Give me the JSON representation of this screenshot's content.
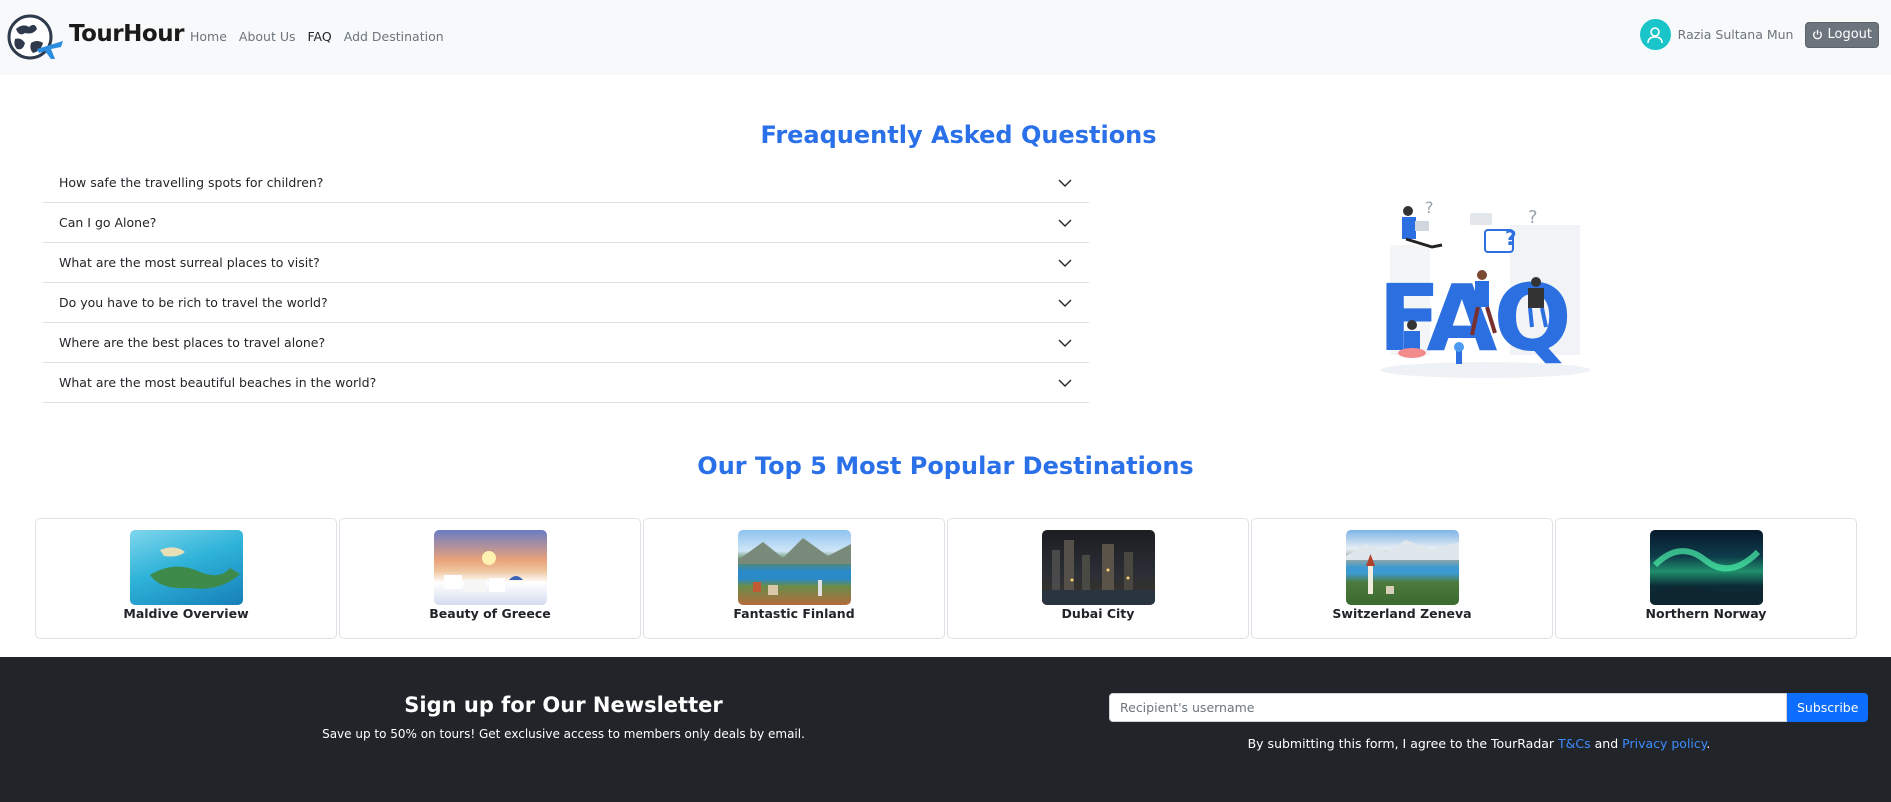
{
  "brand": {
    "name": "TourHour"
  },
  "nav": {
    "links": [
      {
        "label": "Home"
      },
      {
        "label": "About Us"
      },
      {
        "label": "FAQ"
      },
      {
        "label": "Add Destination"
      }
    ],
    "user_name": "Razia Sultana Mun",
    "logout_label": "Logout"
  },
  "faq": {
    "title": "Freaquently Asked Questions",
    "items": [
      {
        "question": "How safe the travelling spots for children?"
      },
      {
        "question": "Can I go Alone?"
      },
      {
        "question": "What are the most surreal places to visit?"
      },
      {
        "question": "Do you have to be rich to travel the world?"
      },
      {
        "question": "Where are the best places to travel alone?"
      },
      {
        "question": "What are the most beautiful beaches in the world?"
      }
    ],
    "illustration_text": "FAQ"
  },
  "destinations": {
    "title": "Our Top 5 Most Popular Destinations",
    "items": [
      {
        "name": "Maldive Overview"
      },
      {
        "name": "Beauty of Greece"
      },
      {
        "name": "Fantastic Finland"
      },
      {
        "name": "Dubai City"
      },
      {
        "name": "Switzerland Zeneva"
      },
      {
        "name": "Northern Norway"
      }
    ]
  },
  "newsletter": {
    "title": "Sign up for Our Newsletter",
    "subtitle": "Save up to 50% on tours! Get exclusive access to members only deals by email.",
    "input_placeholder": "Recipient's username",
    "button_label": "Subscribe",
    "terms_prefix": "By submitting this form, I agree to the TourRadar ",
    "terms_link": "T&Cs",
    "terms_and": " and ",
    "privacy_link": "Privacy policy",
    "terms_suffix": "."
  },
  "colors": {
    "accent": "#2a70e8",
    "footer_bg": "#212529",
    "navbar_bg": "#f8f9fa",
    "avatar": "#19c5c9",
    "primary_button": "#0d6efd"
  }
}
